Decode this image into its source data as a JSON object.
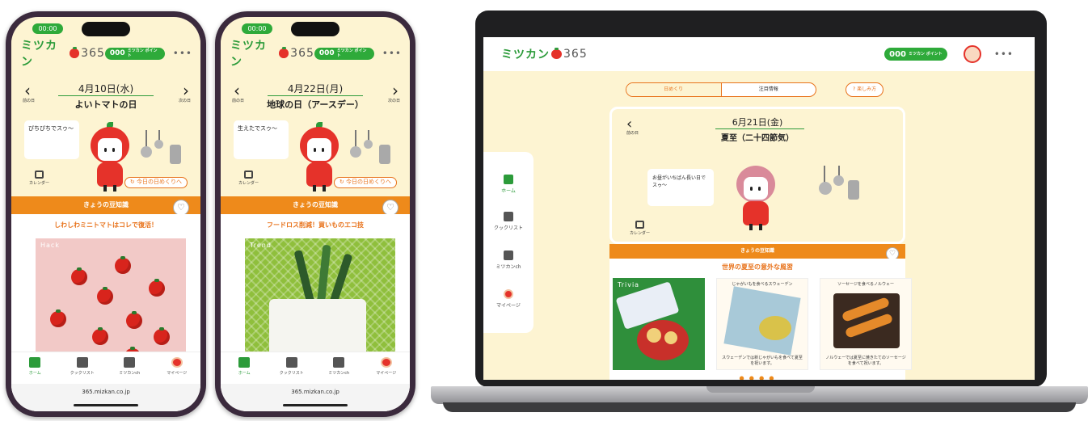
{
  "brand": {
    "logo_text": "ミツカン",
    "logo_number": "365"
  },
  "points": {
    "value": "000",
    "unit": "ミツカン\nポイント"
  },
  "menu_dots": "•••",
  "phone1": {
    "time": "00:00",
    "prev_label": "前の日",
    "next_label": "次の日",
    "date": "4月10日(水)",
    "event": "よいトマトの日",
    "bubble": "ぴちぴちでスゥ〜",
    "calendar_label": "カレンダー",
    "today_button": "今日の日めくりへ",
    "section_title": "きょうの豆知識",
    "trivia_title": "しわしわミニトマトはコレで復活！",
    "art_tag": "Hack",
    "url": "365.mizkan.co.jp"
  },
  "phone2": {
    "time": "00:00",
    "prev_label": "前の日",
    "next_label": "次の日",
    "date": "4月22日(月)",
    "event": "地球の日（アースデー）",
    "bubble": "生えたでスゥ〜",
    "calendar_label": "カレンダー",
    "today_button": "今日の日めくりへ",
    "section_title": "きょうの豆知識",
    "trivia_title": "フードロス削減！買いものエコ技",
    "art_tag": "Trend",
    "url": "365.mizkan.co.jp"
  },
  "tabs": [
    {
      "label": "ホーム",
      "icon": "home-icon"
    },
    {
      "label": "クックリスト",
      "icon": "cooklist-icon"
    },
    {
      "label": "ミツカンch",
      "icon": "chat-icon"
    },
    {
      "label": "マイページ",
      "icon": "avatar-icon"
    }
  ],
  "laptop": {
    "seg_tabs": [
      "日めくり",
      "注目情報"
    ],
    "enjoy_button": "楽しみ方",
    "prev_label": "前の日",
    "date": "6月21日(金)",
    "event": "夏至（二十四節気）",
    "bubble": "お昼がいちばん長い日でスゥ〜",
    "calendar_label": "カレンダー",
    "section_title": "きょうの豆知識",
    "trivia_title": "世界の夏至の意外な風習",
    "thumb1_tag": "Trivia",
    "thumb2_caption_top": "じゃがいもを食べるスウェーデン",
    "thumb2_caption_bottom": "スウェーデンでは新じゃがいもを食べて夏至を祝います。",
    "thumb3_caption_top": "ソーセージを食べるノルウェー",
    "thumb3_caption_bottom": "ノルウェーでは夏至に焼きたてのソーセージを食べて祝います。",
    "pager": "● ● ● ●"
  },
  "colors": {
    "brand_green": "#2c9b3a",
    "accent_orange": "#ee8a1b",
    "tomato_red": "#e5322a",
    "cream": "#fdf4d2"
  }
}
